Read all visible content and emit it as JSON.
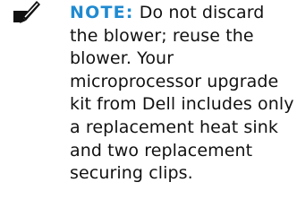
{
  "note": {
    "icon": "pencil-note-icon",
    "label": "NOTE:",
    "lines": [
      " Do not discard",
      "the blower; reuse the",
      "blower. Your",
      "microprocessor upgrade",
      "kit from Dell includes only",
      "a replacement heat sink",
      "and two replacement",
      "securing clips."
    ]
  },
  "colors": {
    "label": "#1f8ad0",
    "text": "#111111",
    "icon": "#111111"
  }
}
